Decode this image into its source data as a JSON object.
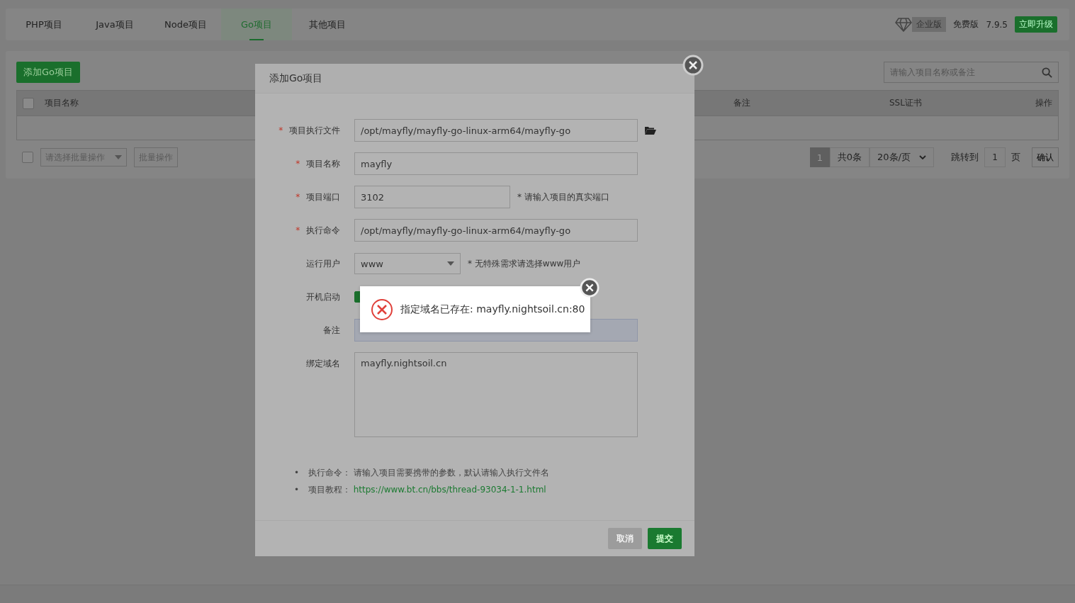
{
  "tabs": [
    {
      "label": "PHP项目",
      "selected": false
    },
    {
      "label": "Java项目",
      "selected": false
    },
    {
      "label": "Node项目",
      "selected": false
    },
    {
      "label": "Go项目",
      "selected": true
    },
    {
      "label": "其他项目",
      "selected": false
    }
  ],
  "edition": {
    "badge": "企业版",
    "label": "免费版",
    "version": "7.9.5",
    "upgrade": "立即升级"
  },
  "toolbar": {
    "add_button": "添加Go项目",
    "search": {
      "placeholder": "请输入项目名称或备注"
    }
  },
  "table": {
    "select_all": {
      "checked": false
    },
    "columns": [
      "项目名称",
      "备注",
      "SSL证书",
      "操作"
    ]
  },
  "batch": {
    "checkbox": {
      "checked": false
    },
    "select": {
      "placeholder": "请选择批量操作"
    },
    "button": "批量操作"
  },
  "pagination": {
    "current": "1",
    "total": "共0条",
    "per_page": "20条/页",
    "jump_label": "跳转到",
    "jump_value": "1",
    "page_unit": "页",
    "confirm": "确认"
  },
  "dialog": {
    "title": "添加Go项目",
    "fields": [
      {
        "kind": "text",
        "mark": "*",
        "label": "项目执行文件",
        "value": "/opt/mayfly/mayfly-go-linux-arm64/mayfly-go",
        "browse": true
      },
      {
        "kind": "text",
        "mark": "*",
        "label": "项目名称",
        "value": "mayfly"
      },
      {
        "kind": "short",
        "mark": "*",
        "label": "项目端口",
        "value": "3102",
        "hint": "* 请输入项目的真实端口"
      },
      {
        "kind": "text",
        "mark": "*",
        "label": "执行命令",
        "value": "/opt/mayfly/mayfly-go-linux-arm64/mayfly-go"
      },
      {
        "kind": "select",
        "label": "运行用户",
        "value": "www",
        "hint": "* 无特殊需求请选择www用户"
      },
      {
        "kind": "checkbox",
        "label": "开机启动",
        "checked": true
      },
      {
        "kind": "text",
        "label": "备注",
        "focused": true
      },
      {
        "kind": "textarea",
        "label": "绑定域名",
        "value": "mayfly.nightsoil.cn"
      }
    ],
    "notes": [
      {
        "bullet": "•",
        "label": "执行命令：",
        "text": "请输入项目需要携带的参数，默认请输入执行文件名"
      },
      {
        "bullet": "•",
        "label": "项目教程：",
        "link": "https://www.bt.cn/bbs/thread-93034-1-1.html"
      }
    ],
    "cancel": "取消",
    "submit": "提交"
  },
  "toast": {
    "message": "指定域名已存在: mayfly.nightsoil.cn:80"
  }
}
